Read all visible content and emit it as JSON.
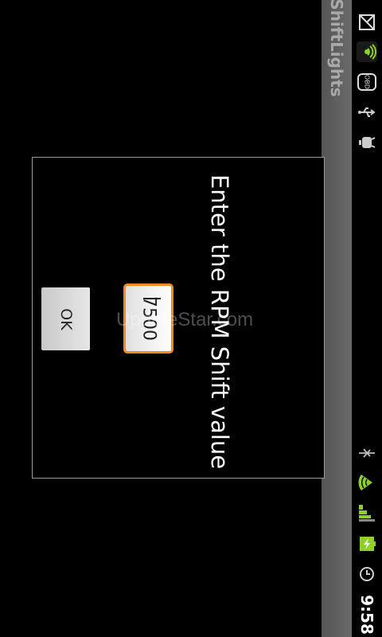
{
  "app": {
    "title": "ShiftLights"
  },
  "status_bar": {
    "time": "9:58",
    "top_icons": [
      "gmail-icon",
      "signal-app-icon",
      "obd-icon",
      "usb-icon",
      "android-debug-icon"
    ],
    "bottom_icons": [
      "bluetooth-icon",
      "wifi-icon",
      "cell-signal-icon",
      "battery-charging-icon",
      "alarm-icon"
    ],
    "obd_label": "OBD"
  },
  "dialog": {
    "prompt": "Enter the RPM Shift value",
    "input_value": "7500",
    "ok_label": "OK"
  },
  "watermark": "UpdateStar.com",
  "colors": {
    "accent": "#f08a22",
    "signal_green": "#8fcf2a",
    "background": "#000000"
  }
}
